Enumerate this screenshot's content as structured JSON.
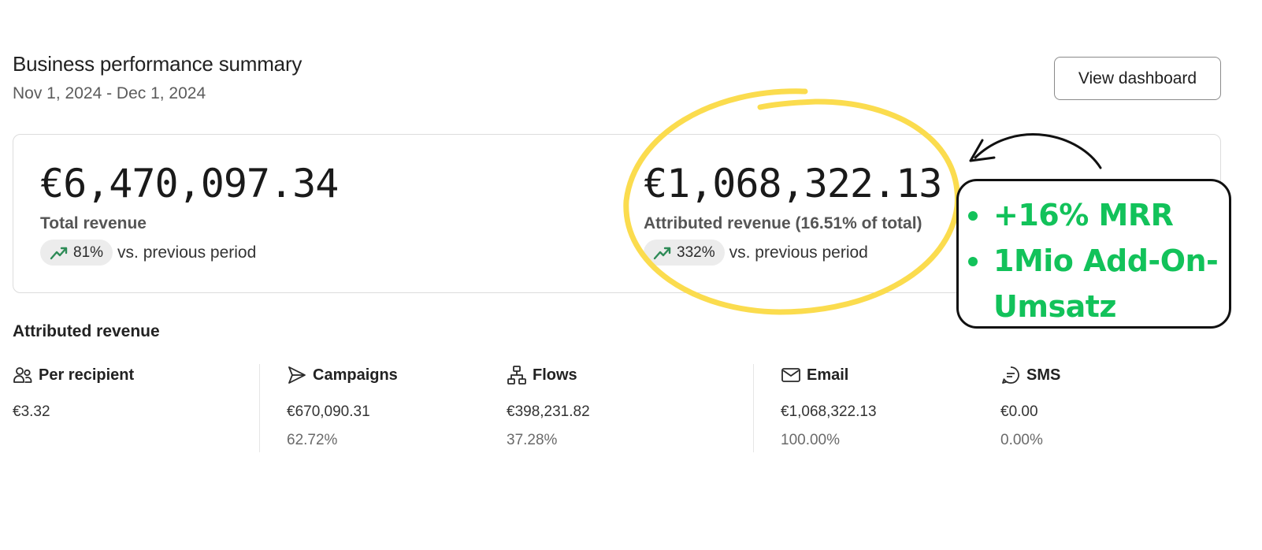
{
  "header": {
    "title": "Business performance summary",
    "date_range": "Nov 1, 2024 - Dec 1, 2024",
    "view_button": "View dashboard"
  },
  "summary": {
    "total": {
      "value": "€6,470,097.34",
      "label": "Total revenue",
      "trend_pct": "81%",
      "trend_suffix": "vs. previous period",
      "trend_icon": "trending-up-icon"
    },
    "attributed": {
      "value": "€1,068,322.13",
      "label": "Attributed revenue (16.51% of total)",
      "trend_pct": "332%",
      "trend_suffix": "vs. previous period",
      "trend_icon": "trending-up-icon"
    }
  },
  "attributed_section": {
    "title": "Attributed revenue",
    "columns": [
      {
        "icon": "people-icon",
        "label": "Per recipient",
        "value": "€3.32",
        "percent": ""
      },
      {
        "icon": "send-icon",
        "label": "Campaigns",
        "value": "€670,090.31",
        "percent": "62.72%"
      },
      {
        "icon": "flow-icon",
        "label": "Flows",
        "value": "€398,231.82",
        "percent": "37.28%"
      },
      {
        "icon": "mail-icon",
        "label": "Email",
        "value": "€1,068,322.13",
        "percent": "100.00%"
      },
      {
        "icon": "sms-icon",
        "label": "SMS",
        "value": "€0.00",
        "percent": "0.00%"
      }
    ]
  },
  "annotation": {
    "bullets": [
      "+16% MRR",
      "1Mio Add-On-Umsatz"
    ],
    "highlight_color": "#fbdc4e",
    "bullet_color": "#12c25a"
  },
  "colors": {
    "trend_green": "#2e8b57",
    "pill_bg": "#ececec"
  }
}
